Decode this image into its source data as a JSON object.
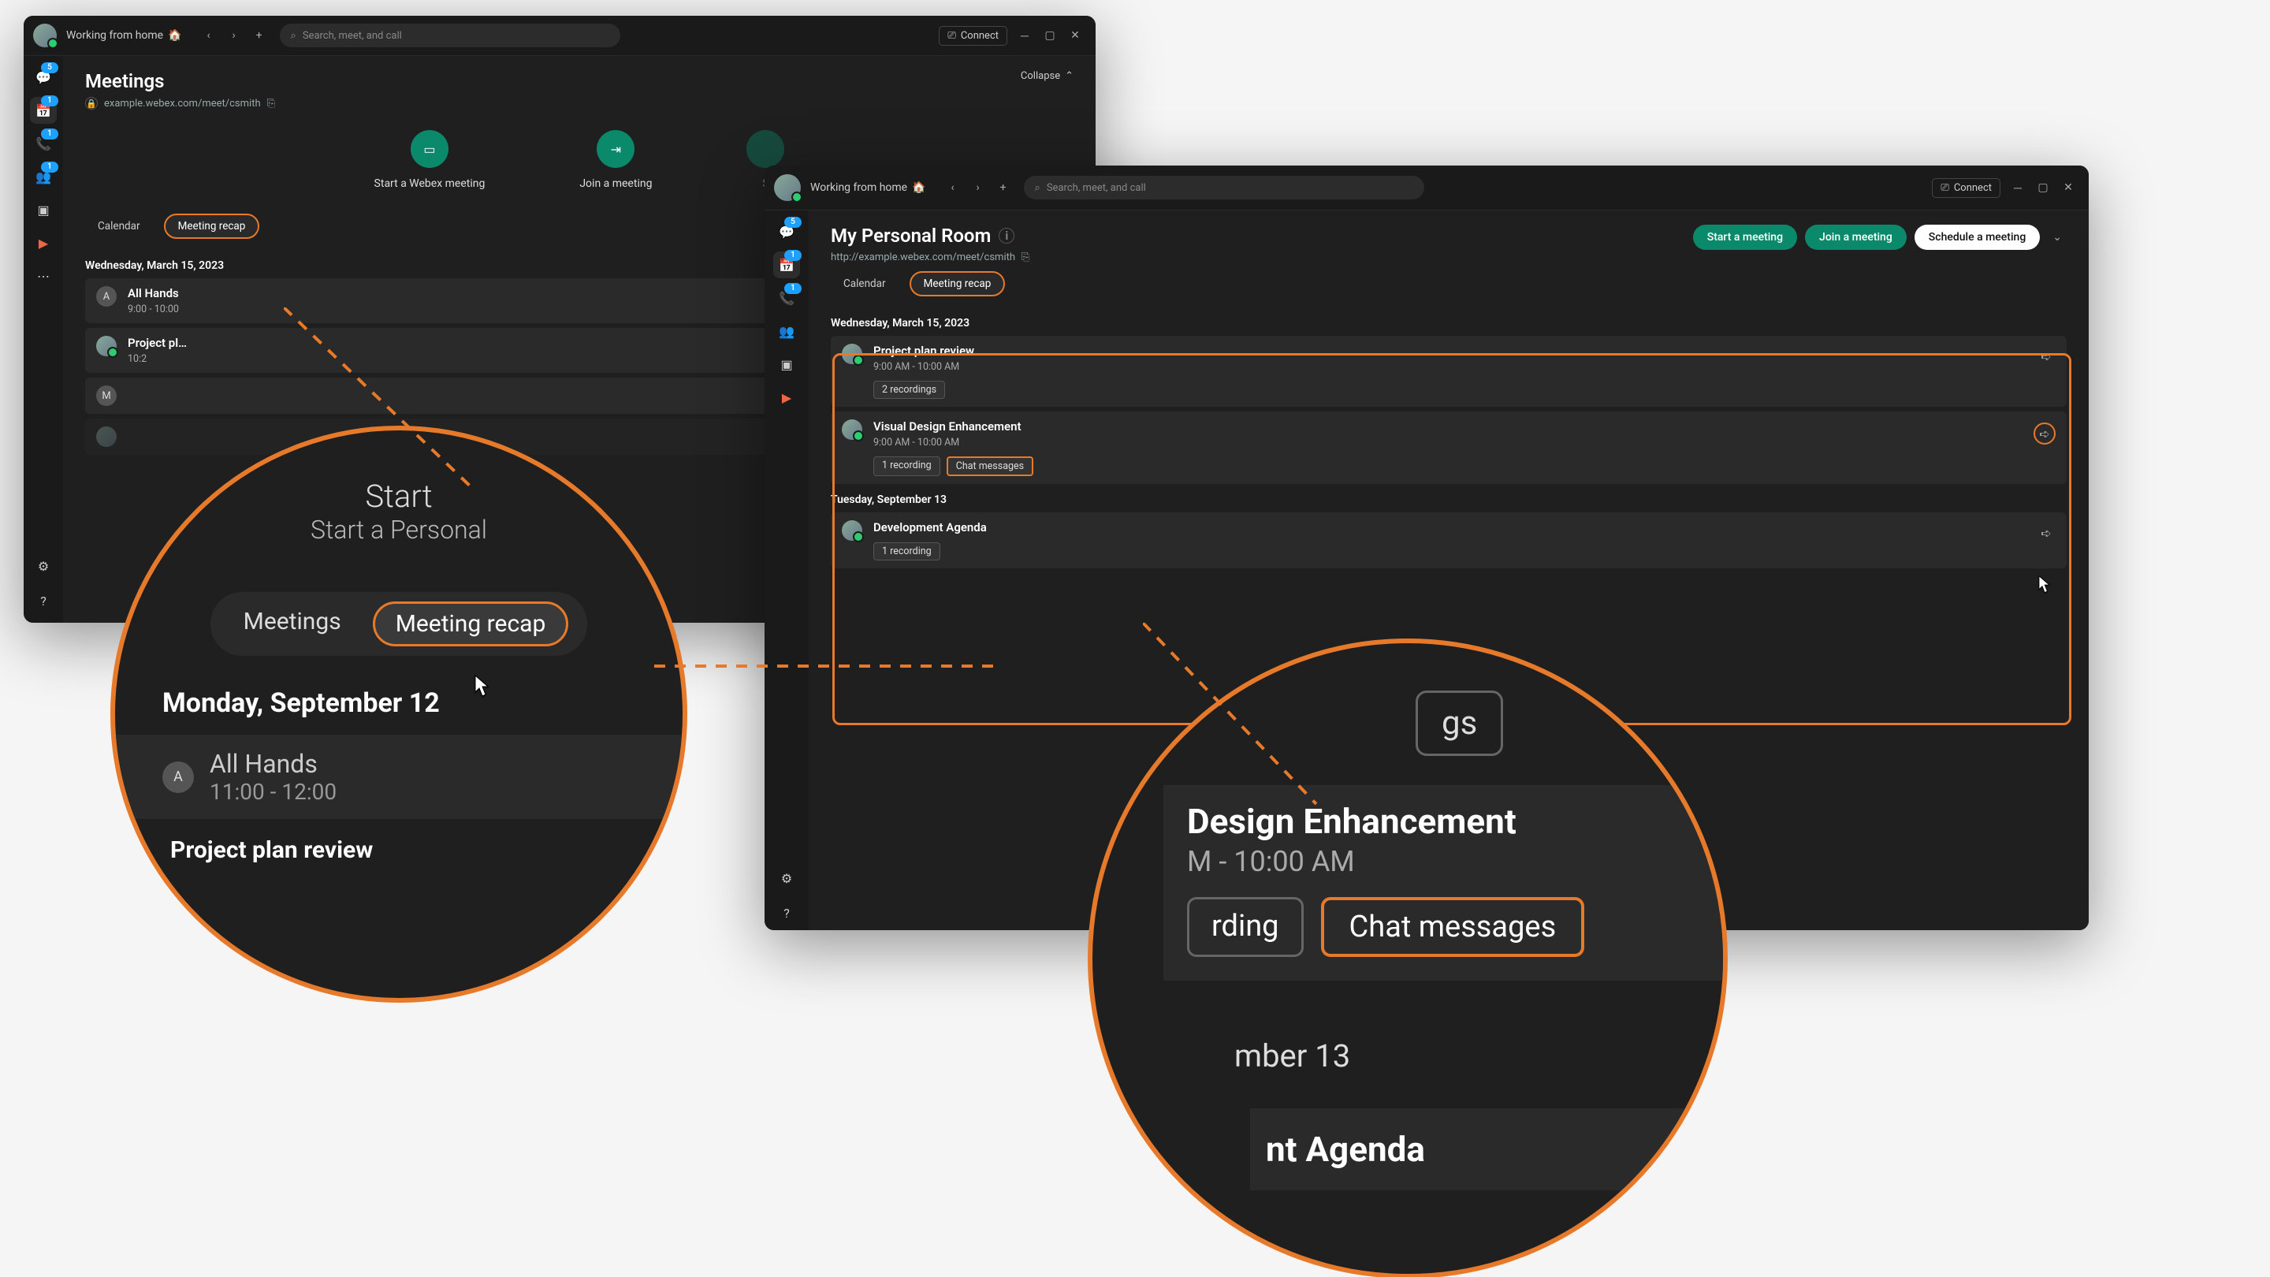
{
  "status_text": "Working from home",
  "search_placeholder": "Search, meet, and call",
  "connect_label": "Connect",
  "rail_badges": {
    "chat": "5",
    "calendar": "1",
    "call": "1",
    "team": "1"
  },
  "window1": {
    "title": "Meetings",
    "url": "example.webex.com/meet/csmith",
    "collapse": "Collapse",
    "quick": {
      "start": "Start a Webex meeting",
      "join": "Join a meeting",
      "sched": "S"
    },
    "tabs": {
      "calendar": "Calendar",
      "recap": "Meeting recap"
    },
    "date": "Wednesday, March 15, 2023",
    "rows": [
      {
        "title": "All Hands",
        "time": "9:00 - 10:00",
        "letter": "A"
      },
      {
        "title": "Project pl…",
        "time": "10:2"
      },
      {
        "title": "",
        "time": "",
        "letter": "M"
      }
    ]
  },
  "window2": {
    "title": "My Personal Room",
    "url": "http://example.webex.com/meet/csmith",
    "actions": {
      "start": "Start a meeting",
      "join": "Join a meeting",
      "sched": "Schedule a meeting"
    },
    "tabs": {
      "calendar": "Calendar",
      "recap": "Meeting recap"
    },
    "groups": [
      {
        "date": "Wednesday, March 15, 2023",
        "rows": [
          {
            "title": "Project plan review",
            "time": "9:00 AM - 10:00 AM",
            "chips": [
              "2 recordings"
            ]
          },
          {
            "title": "Visual Design Enhancement",
            "time": "9:00 AM - 10:00 AM",
            "chips": [
              "1 recording",
              "Chat messages"
            ],
            "hl_chip": 1,
            "hl_arrow": true
          }
        ]
      },
      {
        "date": "Tuesday, September 13",
        "rows": [
          {
            "title": "Development Agenda",
            "time": "",
            "chips": [
              "1 recording"
            ]
          }
        ]
      }
    ]
  },
  "callout1": {
    "tabs": {
      "meetings": "Meetings",
      "recap": "Meeting recap"
    },
    "date": "Monday, September 12",
    "row_title": "All Hands",
    "row_time": "11:00 - 12:00",
    "row2_title": "Project plan review",
    "top_line1": "Start",
    "top_line2": "Start a Personal"
  },
  "callout2": {
    "title": "Design Enhancement",
    "time": "M - 10:00 AM",
    "chip1": "rding",
    "chip2": "Chat messages",
    "date2": "mber 13",
    "title2": "nt Agenda",
    "top_partial": "gs"
  }
}
